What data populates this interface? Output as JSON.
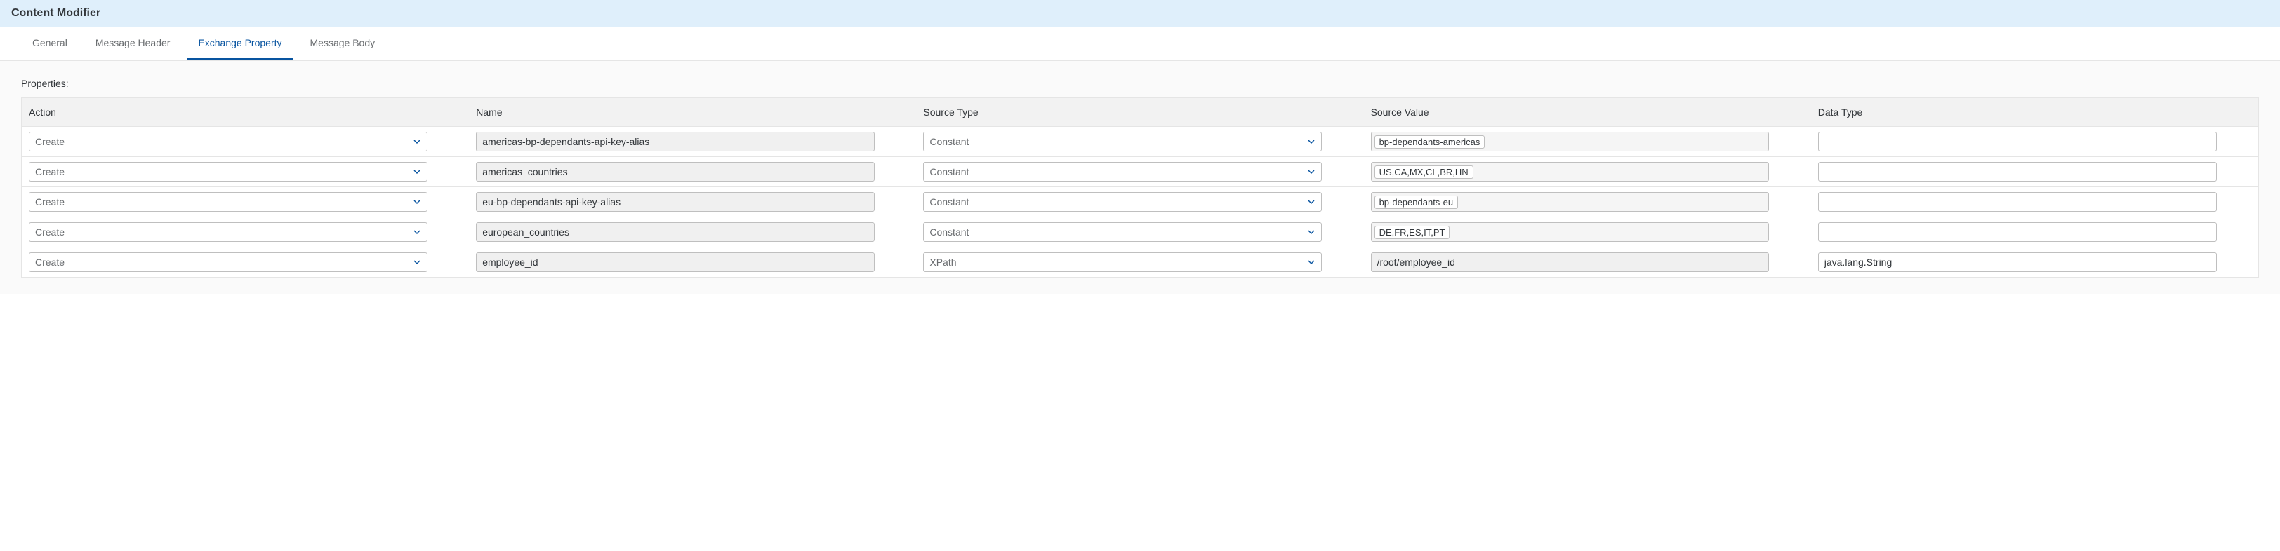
{
  "header": {
    "title": "Content Modifier"
  },
  "tabs": [
    {
      "label": "General",
      "active": false
    },
    {
      "label": "Message Header",
      "active": false
    },
    {
      "label": "Exchange Property",
      "active": true
    },
    {
      "label": "Message Body",
      "active": false
    }
  ],
  "section_label": "Properties:",
  "columns": {
    "action": "Action",
    "name": "Name",
    "source_type": "Source Type",
    "source_value": "Source Value",
    "data_type": "Data Type"
  },
  "rows": [
    {
      "action": "Create",
      "name": "americas-bp-dependants-api-key-alias",
      "source_type": "Constant",
      "source_value": "bp-dependants-americas",
      "source_value_style": "tag",
      "data_type": ""
    },
    {
      "action": "Create",
      "name": "americas_countries",
      "source_type": "Constant",
      "source_value": "US,CA,MX,CL,BR,HN",
      "source_value_style": "tag",
      "data_type": ""
    },
    {
      "action": "Create",
      "name": "eu-bp-dependants-api-key-alias",
      "source_type": "Constant",
      "source_value": "bp-dependants-eu",
      "source_value_style": "tag",
      "data_type": ""
    },
    {
      "action": "Create",
      "name": "european_countries",
      "source_type": "Constant",
      "source_value": "DE,FR,ES,IT,PT",
      "source_value_style": "tag",
      "data_type": ""
    },
    {
      "action": "Create",
      "name": "employee_id",
      "source_type": "XPath",
      "source_value": "/root/employee_id",
      "source_value_style": "input",
      "data_type": "java.lang.String"
    }
  ],
  "colors": {
    "accent": "#0854a0",
    "header_bg": "#dfeffb"
  }
}
